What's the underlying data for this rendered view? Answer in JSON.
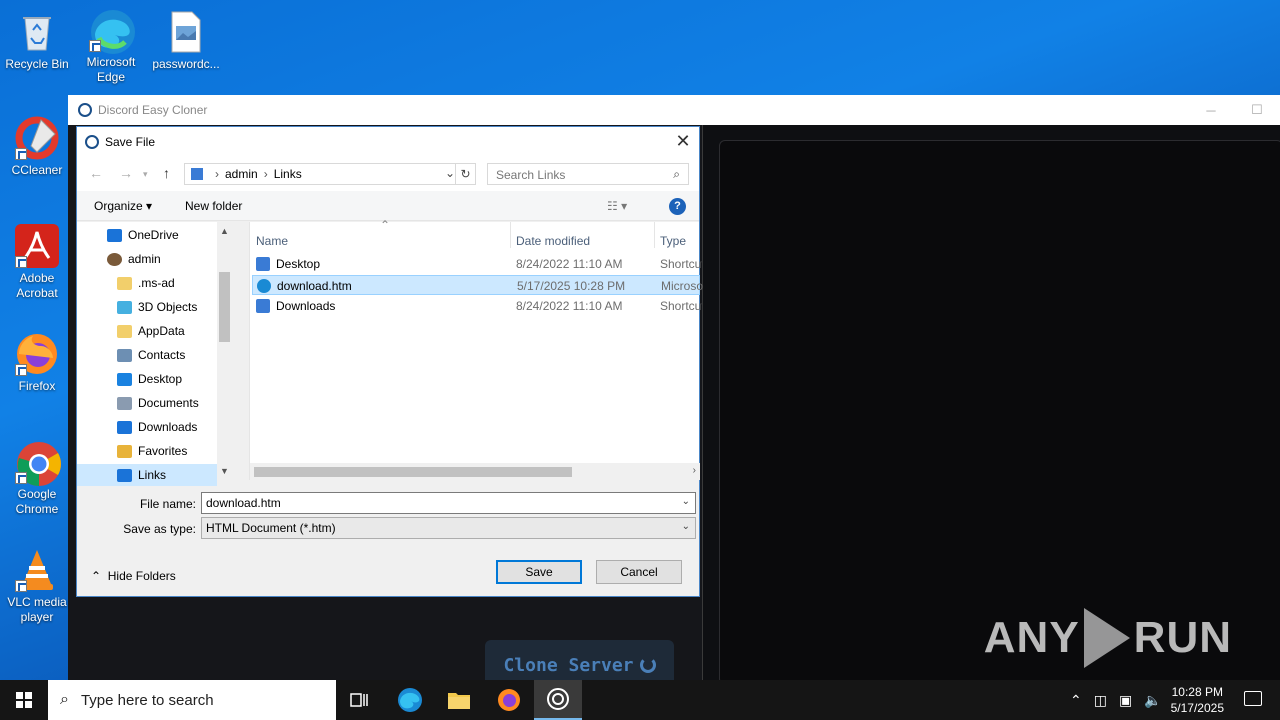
{
  "desktop": {
    "icons": [
      {
        "label": "Recycle Bin"
      },
      {
        "label": "Microsoft Edge"
      },
      {
        "label": "passwordc..."
      },
      {
        "label": "CCleaner"
      },
      {
        "label": "Adobe Acrobat"
      },
      {
        "label": "Firefox"
      },
      {
        "label": "Google Chrome"
      },
      {
        "label": "VLC media player"
      }
    ]
  },
  "app": {
    "title": "Discord Easy Cloner",
    "clone_button": "Clone Server",
    "watermark_left": "ANY",
    "watermark_right": "RUN"
  },
  "dialog": {
    "title": "Save File",
    "close": "✕",
    "address": {
      "root": "admin",
      "current": "Links"
    },
    "search_placeholder": "Search Links",
    "organize": "Organize ▾",
    "new_folder": "New folder",
    "help": "?",
    "tree": [
      {
        "label": "OneDrive",
        "icon": "cloud-icon",
        "color": "#1a73d8"
      },
      {
        "label": "admin",
        "icon": "user-icon",
        "color": "#7a5a3a"
      },
      {
        "label": ".ms-ad",
        "icon": "folder-icon",
        "color": "#f2cf6b"
      },
      {
        "label": "3D Objects",
        "icon": "cube-icon",
        "color": "#45b0e0"
      },
      {
        "label": "AppData",
        "icon": "folder-icon",
        "color": "#f2cf6b"
      },
      {
        "label": "Contacts",
        "icon": "contacts-icon",
        "color": "#6d8fb3"
      },
      {
        "label": "Desktop",
        "icon": "desktop-icon",
        "color": "#1a82e0"
      },
      {
        "label": "Documents",
        "icon": "document-icon",
        "color": "#8a9bb0"
      },
      {
        "label": "Downloads",
        "icon": "download-icon",
        "color": "#1a73d8"
      },
      {
        "label": "Favorites",
        "icon": "star-icon",
        "color": "#e8b33a"
      },
      {
        "label": "Links",
        "icon": "link-icon",
        "color": "#1a73d8",
        "selected": true
      }
    ],
    "columns": {
      "name": "Name",
      "date": "Date modified",
      "type": "Type"
    },
    "files": [
      {
        "name": "Desktop",
        "date": "8/24/2022 11:10 AM",
        "type": "Shortcut",
        "icon": "shortcut-icon"
      },
      {
        "name": "download.htm",
        "date": "5/17/2025 10:28 PM",
        "type": "Microsoft",
        "icon": "edge-file-icon",
        "selected": true
      },
      {
        "name": "Downloads",
        "date": "8/24/2022 11:10 AM",
        "type": "Shortcut",
        "icon": "shortcut-icon"
      }
    ],
    "file_name_label": "File name:",
    "file_name_value": "download.htm",
    "save_type_label": "Save as type:",
    "save_type_value": "HTML Document (*.htm)",
    "save": "Save",
    "cancel": "Cancel",
    "hide_folders": "Hide Folders"
  },
  "taskbar": {
    "search_placeholder": "Type here to search",
    "time": "10:28 PM",
    "date": "5/17/2025"
  }
}
